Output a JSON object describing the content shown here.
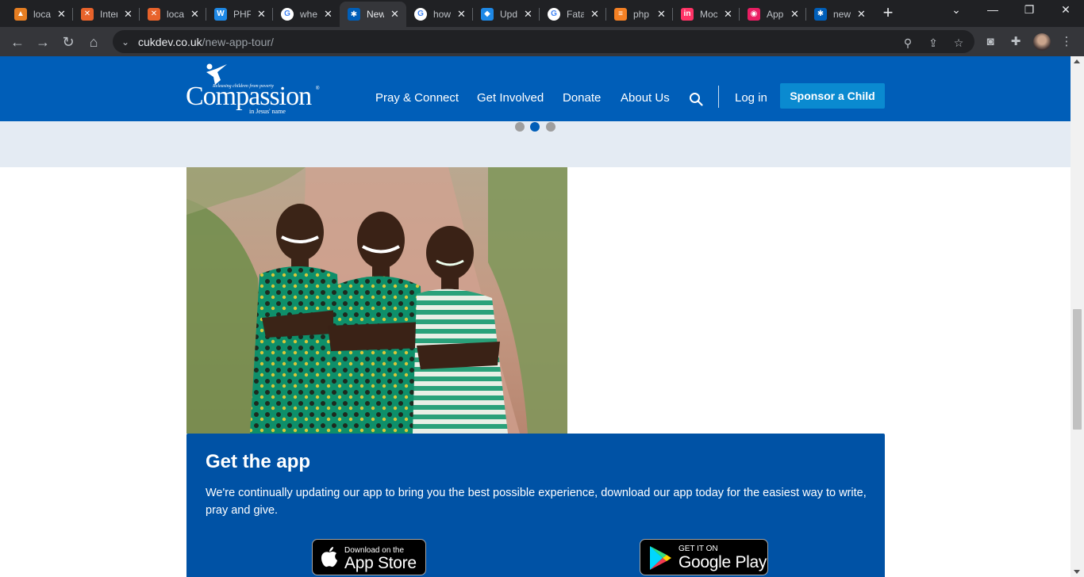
{
  "browser": {
    "tabs": [
      {
        "title": "localhost",
        "favicon_color": "#e67e22",
        "favicon_glyph": "▲"
      },
      {
        "title": "Interface",
        "favicon_color": "#e8632b",
        "favicon_glyph": "✕"
      },
      {
        "title": "localhost",
        "favicon_color": "#e8632b",
        "favicon_glyph": "✕"
      },
      {
        "title": "PHP",
        "favicon_color": "#1e88e5",
        "favicon_glyph": "W"
      },
      {
        "title": "where",
        "favicon_color": "#ffffff",
        "favicon_glyph": "G"
      },
      {
        "title": "New App Tour",
        "favicon_color": "#005eb8",
        "favicon_glyph": "✱",
        "active": true
      },
      {
        "title": "how",
        "favicon_color": "#ffffff",
        "favicon_glyph": "G"
      },
      {
        "title": "Update",
        "favicon_color": "#1e88e5",
        "favicon_glyph": "◆"
      },
      {
        "title": "Fatal",
        "favicon_color": "#ffffff",
        "favicon_glyph": "G"
      },
      {
        "title": "php",
        "favicon_color": "#f48024",
        "favicon_glyph": "≡"
      },
      {
        "title": "Mock",
        "favicon_color": "#ff3366",
        "favicon_glyph": "in"
      },
      {
        "title": "App",
        "favicon_color": "#e91e63",
        "favicon_glyph": "◉"
      },
      {
        "title": "new",
        "favicon_color": "#005eb8",
        "favicon_glyph": "✱"
      }
    ],
    "close_glyph": "✕",
    "new_tab_glyph": "+",
    "url_domain": "cukdev.co.uk",
    "url_path": "/new-app-tour/"
  },
  "site": {
    "logo": {
      "tagline": "Releasing children from poverty",
      "wordmark": "Compassion",
      "sub": "in Jesus' name",
      "reg": "®"
    },
    "nav": [
      {
        "label": "Pray & Connect"
      },
      {
        "label": "Get Involved"
      },
      {
        "label": "Donate"
      },
      {
        "label": "About Us"
      }
    ],
    "login_label": "Log in",
    "sponsor_label": "Sponsor a Child",
    "carousel_active_index": 1,
    "app_section": {
      "title": "Get the app",
      "text": "We're continually updating our app to bring you the best possible experience, download our app today for the easiest way to write, pray and give.",
      "app_store": {
        "small": "Download on the",
        "big": "App Store"
      },
      "google_play": {
        "small": "GET IT ON",
        "big": "Google Play"
      }
    }
  },
  "colors": {
    "brand_blue": "#005eb8",
    "panel_blue": "#0052a5",
    "sponsor_button": "#0a8ad0",
    "band": "#e4ebf3"
  }
}
